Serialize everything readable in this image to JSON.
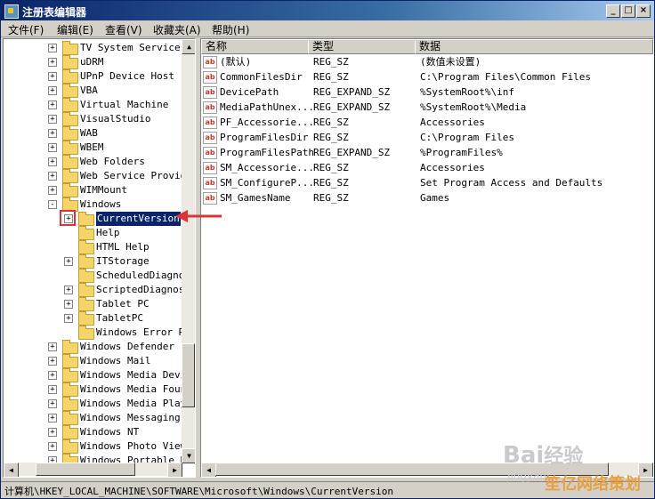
{
  "window": {
    "title": "注册表编辑器",
    "min": "_",
    "max": "□",
    "close": "×"
  },
  "menu": [
    "文件(F)",
    "编辑(E)",
    "查看(V)",
    "收藏夹(A)",
    "帮助(H)"
  ],
  "tree": [
    {
      "label": "TV System Services",
      "expand": "+",
      "depth": 0
    },
    {
      "label": "uDRM",
      "expand": "+",
      "depth": 0
    },
    {
      "label": "UPnP Device Host",
      "expand": "+",
      "depth": 0
    },
    {
      "label": "VBA",
      "expand": "+",
      "depth": 0
    },
    {
      "label": "Virtual Machine",
      "expand": "+",
      "depth": 0
    },
    {
      "label": "VisualStudio",
      "expand": "+",
      "depth": 0
    },
    {
      "label": "WAB",
      "expand": "+",
      "depth": 0
    },
    {
      "label": "WBEM",
      "expand": "+",
      "depth": 0
    },
    {
      "label": "Web Folders",
      "expand": "+",
      "depth": 0
    },
    {
      "label": "Web Service Provide",
      "expand": "+",
      "depth": 0
    },
    {
      "label": "WIMMount",
      "expand": "+",
      "depth": 0
    },
    {
      "label": "Windows",
      "expand": "-",
      "depth": 0
    },
    {
      "label": "CurrentVersion",
      "expand": "+",
      "depth": 1,
      "selected": true
    },
    {
      "label": "Help",
      "expand": "",
      "depth": 1
    },
    {
      "label": "HTML Help",
      "expand": "",
      "depth": 1
    },
    {
      "label": "ITStorage",
      "expand": "+",
      "depth": 1
    },
    {
      "label": "ScheduledDiagnos",
      "expand": "",
      "depth": 1
    },
    {
      "label": "ScriptedDiagnost",
      "expand": "+",
      "depth": 1
    },
    {
      "label": "Tablet PC",
      "expand": "+",
      "depth": 1
    },
    {
      "label": "TabletPC",
      "expand": "+",
      "depth": 1
    },
    {
      "label": "Windows Error Re",
      "expand": "",
      "depth": 1
    },
    {
      "label": "Windows Defender",
      "expand": "+",
      "depth": 0
    },
    {
      "label": "Windows Mail",
      "expand": "+",
      "depth": 0
    },
    {
      "label": "Windows Media Devic",
      "expand": "+",
      "depth": 0
    },
    {
      "label": "Windows Media Found",
      "expand": "+",
      "depth": 0
    },
    {
      "label": "Windows Media Playe",
      "expand": "+",
      "depth": 0
    },
    {
      "label": "Windows Messaging S",
      "expand": "+",
      "depth": 0
    },
    {
      "label": "Windows NT",
      "expand": "+",
      "depth": 0
    },
    {
      "label": "Windows Photo Viewe",
      "expand": "+",
      "depth": 0
    },
    {
      "label": "Windows Portable De",
      "expand": "+",
      "depth": 0
    }
  ],
  "values_header": {
    "name": "名称",
    "type": "类型",
    "data": "数据"
  },
  "values": [
    {
      "name": "(默认)",
      "type": "REG_SZ",
      "data": "(数值未设置)"
    },
    {
      "name": "CommonFilesDir",
      "type": "REG_SZ",
      "data": "C:\\Program Files\\Common Files"
    },
    {
      "name": "DevicePath",
      "type": "REG_EXPAND_SZ",
      "data": "%SystemRoot%\\inf"
    },
    {
      "name": "MediaPathUnex...",
      "type": "REG_EXPAND_SZ",
      "data": "%SystemRoot%\\Media"
    },
    {
      "name": "PF_Accessorie...",
      "type": "REG_SZ",
      "data": "Accessories"
    },
    {
      "name": "ProgramFilesDir",
      "type": "REG_SZ",
      "data": "C:\\Program Files"
    },
    {
      "name": "ProgramFilesPath",
      "type": "REG_EXPAND_SZ",
      "data": "%ProgramFiles%"
    },
    {
      "name": "SM_Accessorie...",
      "type": "REG_SZ",
      "data": "Accessories"
    },
    {
      "name": "SM_ConfigureP...",
      "type": "REG_SZ",
      "data": "Set Program Access and Defaults"
    },
    {
      "name": "SM_GamesName",
      "type": "REG_SZ",
      "data": "Games"
    }
  ],
  "value_icon": "ab",
  "status": "计算机\\HKEY_LOCAL_MACHINE\\SOFTWARE\\Microsoft\\Windows\\CurrentVersion",
  "watermark": {
    "text1": "Bai",
    "text2": "经验",
    "text3": "jingyan",
    "text4": "笙亿网络策划"
  },
  "colors": {
    "accent": "#0a246a",
    "arrow": "#d9343a",
    "watermark_orange": "#e8a040"
  }
}
